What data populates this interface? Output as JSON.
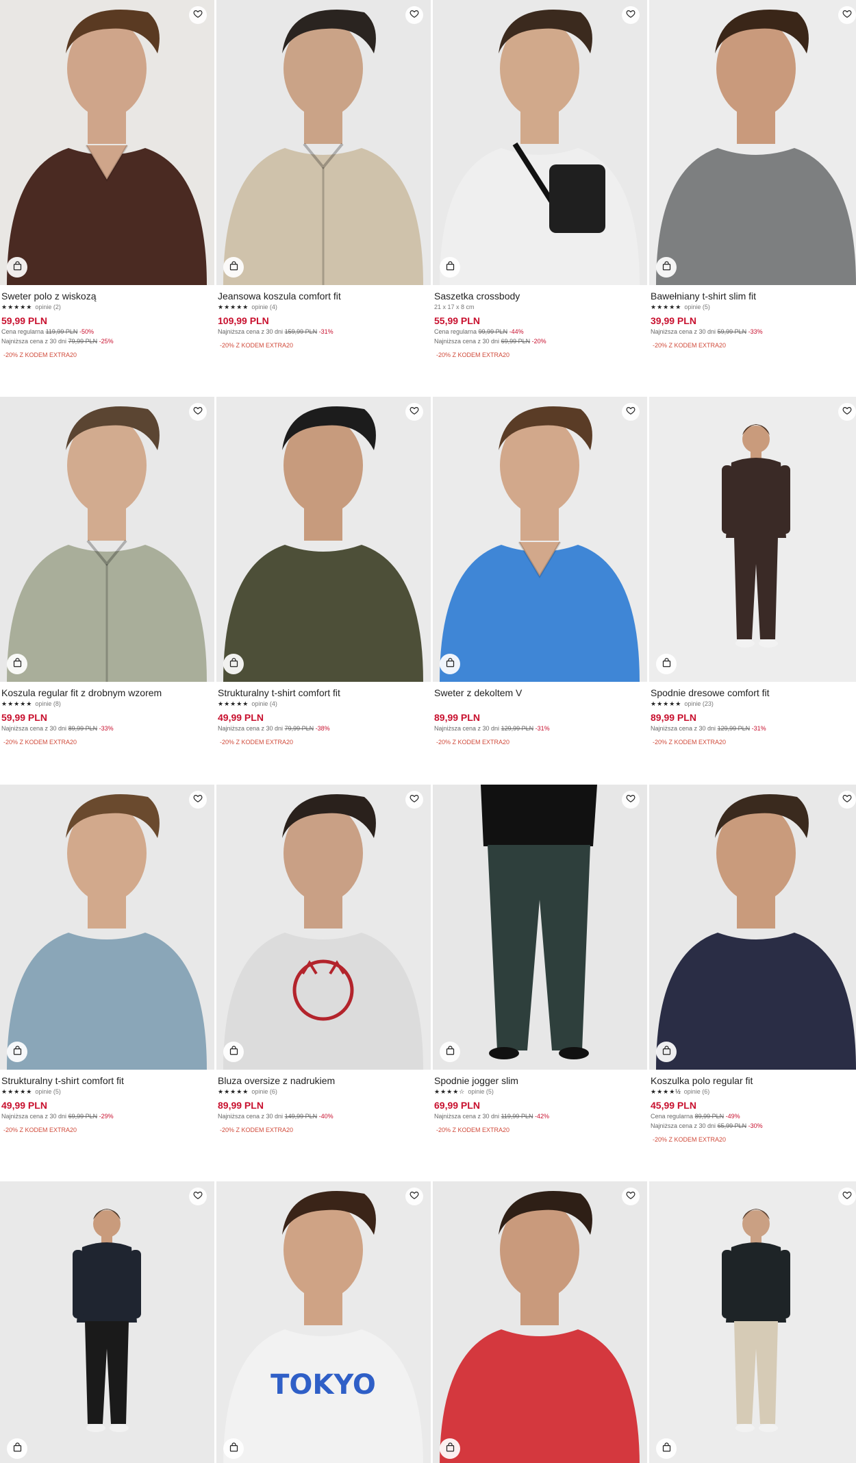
{
  "products": [
    {
      "name": "Sweter polo z wiskozą",
      "stars": "★★★★★",
      "reviews": "opinie (2)",
      "price": "59,99 PLN",
      "lines": [
        {
          "label": "Cena regularna",
          "old": "119,99 PLN",
          "disc": "-50%"
        },
        {
          "label": "Najniższa cena z 30 dni",
          "old": "79,99 PLN",
          "disc": "-25%"
        }
      ],
      "promo": "-20% Z KODEM EXTRA20",
      "bg": "#e9e7e4",
      "garment": "#4a2a22",
      "skin": "#cfa58a",
      "hair": "#5a3a22",
      "shape": "sweater"
    },
    {
      "name": "Jeansowa koszula comfort fit",
      "stars": "★★★★★",
      "reviews": "opinie (4)",
      "price": "109,99 PLN",
      "lines": [
        {
          "label": "Najniższa cena z 30 dni",
          "old": "159,99 PLN",
          "disc": "-31%"
        }
      ],
      "promo": "-20% Z KODEM EXTRA20",
      "bg": "#e8e8e8",
      "garment": "#cfc2ab",
      "skin": "#caa387",
      "hair": "#2a2420",
      "shape": "shirt"
    },
    {
      "name": "Saszetka crossbody",
      "subtitle": "21 x 17 x 8 cm",
      "price": "55,99 PLN",
      "lines": [
        {
          "label": "Cena regularna",
          "old": "99,99 PLN",
          "disc": "-44%"
        },
        {
          "label": "Najniższa cena z 30 dni",
          "old": "69,99 PLN",
          "disc": "-20%"
        }
      ],
      "promo": "-20% Z KODEM EXTRA20",
      "bg": "#e9e9e9",
      "garment": "#efefef",
      "skin": "#d1a98b",
      "hair": "#3b2a1e",
      "shape": "bag"
    },
    {
      "name": "Bawełniany t-shirt slim fit",
      "stars": "★★★★★",
      "reviews": "opinie (5)",
      "price": "39,99 PLN",
      "lines": [
        {
          "label": "Najniższa cena z 30 dni",
          "old": "59,99 PLN",
          "disc": "-33%"
        }
      ],
      "promo": "-20% Z KODEM EXTRA20",
      "bg": "#ececec",
      "garment": "#7d7f80",
      "skin": "#c99a7c",
      "hair": "#3a2618",
      "shape": "tshirt"
    },
    {
      "name": "Koszula regular fit z drobnym wzorem",
      "stars": "★★★★★",
      "reviews": "opinie (8)",
      "price": "59,99 PLN",
      "lines": [
        {
          "label": "Najniższa cena z 30 dni",
          "old": "89,99 PLN",
          "disc": "-33%"
        }
      ],
      "promo": "-20% Z KODEM EXTRA20",
      "bg": "#e8e8e8",
      "garment": "#a9ae9a",
      "skin": "#d2ab8f",
      "hair": "#5b4532",
      "shape": "shirt"
    },
    {
      "name": "Strukturalny t-shirt comfort fit",
      "stars": "★★★★★",
      "reviews": "opinie (4)",
      "price": "49,99 PLN",
      "lines": [
        {
          "label": "Najniższa cena z 30 dni",
          "old": "79,99 PLN",
          "disc": "-38%"
        }
      ],
      "promo": "-20% Z KODEM EXTRA20",
      "bg": "#eaeaea",
      "garment": "#4d4f38",
      "skin": "#c79b7d",
      "hair": "#1c1c1c",
      "shape": "tshirt"
    },
    {
      "name": "Sweter z dekoltem V",
      "price": "89,99 PLN",
      "lines": [
        {
          "label": "Najniższa cena z 30 dni",
          "old": "129,99 PLN",
          "disc": "-31%"
        }
      ],
      "promo": "-20% Z KODEM EXTRA20",
      "bg": "#ebebeb",
      "garment": "#3f86d6",
      "skin": "#d2a88b",
      "hair": "#5a3c26",
      "shape": "sweater"
    },
    {
      "name": "Spodnie dresowe comfort fit",
      "stars": "★★★★★",
      "reviews": "opinie (23)",
      "price": "89,99 PLN",
      "lines": [
        {
          "label": "Najniższa cena z 30 dni",
          "old": "129,99 PLN",
          "disc": "-31%"
        }
      ],
      "promo": "-20% Z KODEM EXTRA20",
      "bg": "#ededed",
      "garment": "#3a2a26",
      "skin": "#c99b7c",
      "hair": "#4a3020",
      "shape": "full"
    },
    {
      "name": "Strukturalny t-shirt comfort fit",
      "stars": "★★★★★",
      "reviews": "opinie (5)",
      "price": "49,99 PLN",
      "lines": [
        {
          "label": "Najniższa cena z 30 dni",
          "old": "69,99 PLN",
          "disc": "-29%"
        }
      ],
      "promo": "-20% Z KODEM EXTRA20",
      "bg": "#e8e8e8",
      "garment": "#8aa6b8",
      "skin": "#d2a98c",
      "hair": "#6a4a2e",
      "shape": "tshirt"
    },
    {
      "name": "Bluza oversize z nadrukiem",
      "stars": "★★★★★",
      "reviews": "opinie (6)",
      "price": "89,99 PLN",
      "lines": [
        {
          "label": "Najniższa cena z 30 dni",
          "old": "149,99 PLN",
          "disc": "-40%"
        }
      ],
      "promo": "-20% Z KODEM EXTRA20",
      "bg": "#e9e9e9",
      "garment": "#dcdcdc",
      "skin": "#c9a085",
      "hair": "#2a211c",
      "shape": "print-red"
    },
    {
      "name": "Spodnie jogger slim",
      "stars": "★★★★☆",
      "reviews": "opinie (5)",
      "price": "69,99 PLN",
      "lines": [
        {
          "label": "Najniższa cena z 30 dni",
          "old": "119,99 PLN",
          "disc": "-42%"
        }
      ],
      "promo": "-20% Z KODEM EXTRA20",
      "bg": "#e7e7e7",
      "garment": "#2e3f3c",
      "skin": "#c99b7c",
      "hair": "#1c1c1c",
      "shape": "pants"
    },
    {
      "name": "Koszulka polo regular fit",
      "stars": "★★★★½",
      "reviews": "opinie (6)",
      "price": "45,99 PLN",
      "lines": [
        {
          "label": "Cena regularna",
          "old": "89,99 PLN",
          "disc": "-49%"
        },
        {
          "label": "Najniższa cena z 30 dni",
          "old": "65,99 PLN",
          "disc": "-30%"
        }
      ],
      "promo": "-20% Z KODEM EXTRA20",
      "bg": "#e8e8e8",
      "garment": "#2a2d45",
      "skin": "#c99b7c",
      "hair": "#3a2a1e",
      "shape": "tshirt"
    },
    {
      "bg": "#e9e9e9",
      "garment": "#1f2530",
      "skin": "#c99b7c",
      "hair": "#4a3526",
      "shape": "full"
    },
    {
      "bg": "#eaeaea",
      "garment": "#f2f2f2",
      "skin": "#cfa385",
      "hair": "#3a2418",
      "shape": "print-blue",
      "print_text": "TOKYO"
    },
    {
      "bg": "#e8e8e8",
      "garment": "#d4383e",
      "skin": "#c99a7c",
      "hair": "#2e1f16",
      "shape": "tshirt"
    },
    {
      "bg": "#ececec",
      "garment": "#1e2427",
      "skin": "#caa083",
      "hair": "#5a4030",
      "shape": "full"
    }
  ],
  "icons": {
    "favorite": "heart-icon",
    "bag": "shopping-bag-icon"
  }
}
